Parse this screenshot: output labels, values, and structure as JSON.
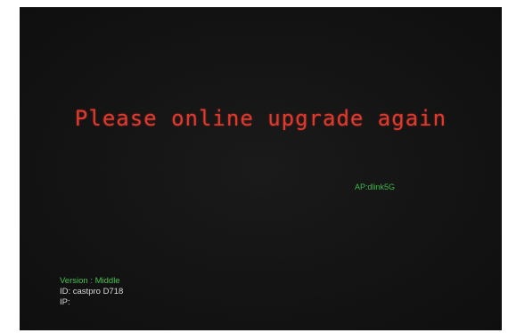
{
  "screen": {
    "message": "Please online upgrade again",
    "ap": "AP:dlink5G",
    "version": "Version : Middle",
    "id": "ID: castpro D718",
    "ip": "IP:"
  },
  "colors": {
    "background": "#141414",
    "message": "#e03a2e",
    "ap": "#3fb54a",
    "version": "#49c050",
    "info": "#d8d8d8"
  }
}
